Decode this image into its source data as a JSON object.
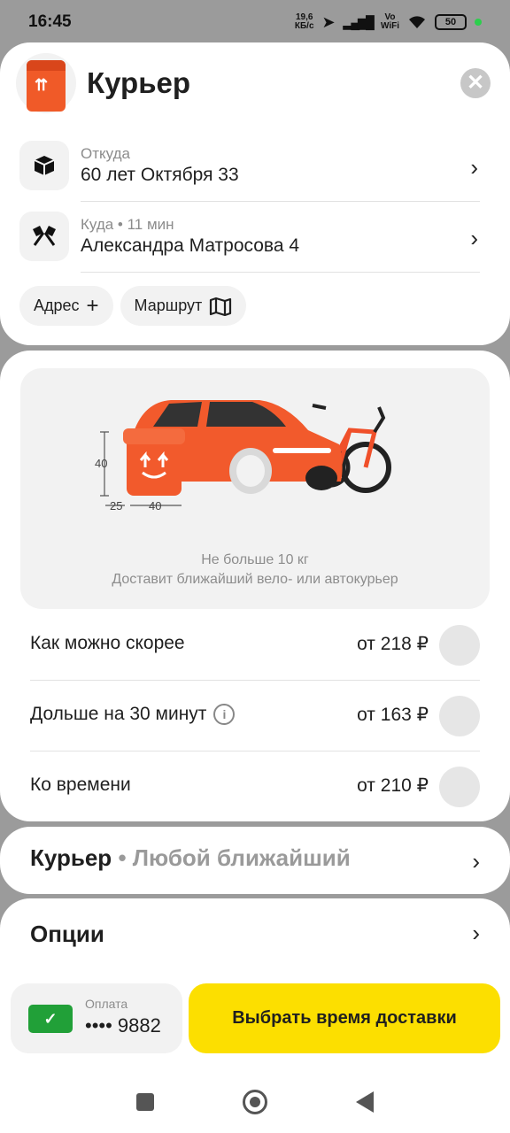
{
  "status_bar": {
    "time": "16:45",
    "net_speed_top": "19,6",
    "net_speed_bottom": "КБ/с",
    "vowifi_top": "Vo",
    "vowifi_bottom": "WiFi",
    "battery": "50"
  },
  "header": {
    "title": "Курьер",
    "logo_glyph": "⇈"
  },
  "route": {
    "from": {
      "label": "Откуда",
      "value": "60 лет Октября 33"
    },
    "to": {
      "label": "Куда • 11 мин",
      "value": "Александра Матросова 4"
    }
  },
  "chips": {
    "address_label": "Адрес",
    "route_label": "Маршрут"
  },
  "illustration": {
    "dim_height": "40",
    "dim_width_left": "25",
    "dim_width_right": "40",
    "caption_1": "Не больше 10 кг",
    "caption_2": "Доставит ближайший вело- или автокурьер"
  },
  "tariffs": [
    {
      "name": "Как можно скорее",
      "price": "от 218 ₽"
    },
    {
      "name": "Дольше на 30 минут",
      "price": "от 163 ₽"
    },
    {
      "name": "Ко времени",
      "price": "от 210 ₽"
    }
  ],
  "courier": {
    "title": "Курьер",
    "subtitle": "• Любой ближайший"
  },
  "options": {
    "title": "Опции"
  },
  "payment": {
    "label": "Оплата",
    "number": "•••• 9882"
  },
  "cta": {
    "label": "Выбрать время доставки"
  },
  "colors": {
    "accent_yellow": "#fcdf00",
    "brand_orange": "#f05a28",
    "card_green": "#21a038"
  }
}
